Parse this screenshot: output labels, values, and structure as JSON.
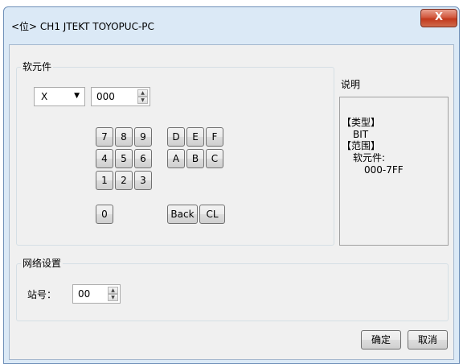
{
  "window": {
    "title": "<位> CH1 JTEKT TOYOPUC-PC",
    "close_label": "X"
  },
  "device_group": {
    "label": "软元件",
    "device_type": "X",
    "device_address": "000",
    "keys": {
      "k7": "7",
      "k8": "8",
      "k9": "9",
      "k4": "4",
      "k5": "5",
      "k6": "6",
      "k1": "1",
      "k2": "2",
      "k3": "3",
      "k0": "0",
      "kD": "D",
      "kE": "E",
      "kF": "F",
      "kA": "A",
      "kB": "B",
      "kC": "C",
      "back": "Back",
      "clear": "CL"
    }
  },
  "description": {
    "label": "说明",
    "type_header": "【类型】",
    "type_value": "BIT",
    "range_header": "【范围】",
    "range_device": "软元件:",
    "range_value": "000-7FF"
  },
  "network_group": {
    "label": "网络设置",
    "station_label": "站号：",
    "station_value": "00"
  },
  "buttons": {
    "ok": "确定",
    "cancel": "取消"
  }
}
